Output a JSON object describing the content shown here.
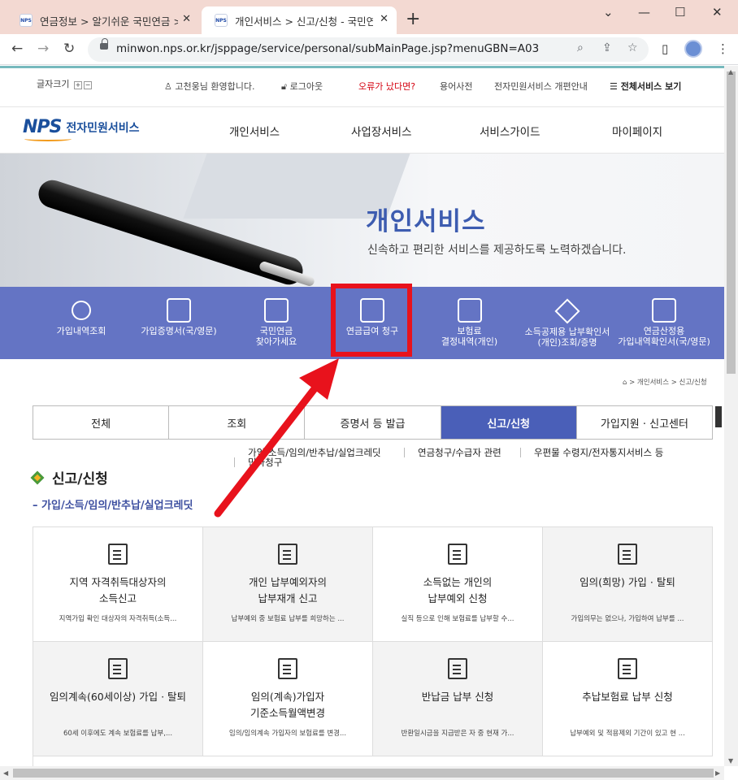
{
  "browser": {
    "tabs": [
      {
        "favicon": "NPS",
        "title": "연금정보 > 알기쉬운 국민연금 > 연금제도",
        "close": "✕"
      },
      {
        "favicon": "NPS",
        "title": "개인서비스 > 신고/신청 - 국민연금",
        "close": "✕"
      }
    ],
    "new_tab": "+",
    "window_controls": {
      "minimize": "—",
      "maximize": "☐",
      "close": "✕",
      "dropdown": "⌄"
    },
    "nav": {
      "back": "←",
      "forward": "→",
      "reload": "↻"
    },
    "url": "minwon.nps.or.kr/jsppage/service/personal/subMainPage.jsp?menuGBN=A03",
    "icons": {
      "zoom": "⌕",
      "share": "⇪",
      "bookmark": "☆",
      "sidepanel": "▯",
      "menu": "⋮"
    }
  },
  "utility": {
    "font_size_label": "글자크기",
    "plus": "+",
    "minus": "−",
    "greeting": "고천웅님 환영합니다.",
    "logout": "로그아웃",
    "error_report": "오류가 났다면?",
    "glossary": "용어사전",
    "renewal_notice": "전자민원서비스 개편안내",
    "all_services": "☰ 전체서비스 보기"
  },
  "logo": {
    "mark": "NPS",
    "text": "전자민원서비스"
  },
  "gnb": [
    "개인서비스",
    "사업장서비스",
    "서비스가이드",
    "마이페이지"
  ],
  "banner": {
    "title": "개인서비스",
    "subtitle": "신속하고 편리한 서비스를 제공하도록 노력하겠습니다."
  },
  "quick_menu": [
    {
      "line1": "가입내역조회",
      "line2": ""
    },
    {
      "line1": "가입증명서(국/영문)",
      "line2": ""
    },
    {
      "line1": "국민연금",
      "line2": "찾아가세요"
    },
    {
      "line1": "연금급여 청구",
      "line2": ""
    },
    {
      "line1": "보험료",
      "line2": "결정내역(개인)"
    },
    {
      "line1": "소득공제용 납부확인서",
      "line2": "(개인)조회/증명"
    },
    {
      "line1": "연금산정용",
      "line2": "가입내역확인서(국/영문)"
    }
  ],
  "breadcrumb": {
    "home_icon": "⌂",
    "path": " > 개인서비스 > 신고/신청"
  },
  "tabs": [
    "전체",
    "조회",
    "증명서 등 발급",
    "신고/신청",
    "가입지원 · 신고센터"
  ],
  "active_tab": "신고/신청",
  "subnav": [
    "가입/소득/임의/반추납/실업크레딧",
    "연금청구/수급자 관련",
    "우편물 수령지/전자통지서비스 등",
    "민사청구"
  ],
  "section": {
    "title": "신고/신청",
    "subtitle": "가입/소득/임의/반추납/실업크레딧",
    "dash": "–"
  },
  "cards": [
    {
      "title1": "지역 자격취득대상자의",
      "title2": "소득신고",
      "desc": "지역가입 확인 대상자의 자격취득(소득..."
    },
    {
      "title1": "개인 납부예외자의",
      "title2": "납부재개 신고",
      "desc": "납부예외 중 보험료 납부를 희망하는 ..."
    },
    {
      "title1": "소득없는 개인의",
      "title2": "납부예외 신청",
      "desc": "실직 등으로 인해 보험료를 납부할 수..."
    },
    {
      "title1": "임의(희망) 가입 · 탈퇴",
      "title2": "",
      "desc": "가입의무는 없으나, 가입하여 납부를 ..."
    },
    {
      "title1": "임의계속(60세이상) 가입 · 탈퇴",
      "title2": "",
      "desc": "60세 이후에도 계속 보험료를 납부,..."
    },
    {
      "title1": "임의(계속)가입자",
      "title2": "기준소득월액변경",
      "desc": "임의/임의계속 가입자의 보험료를 변경..."
    },
    {
      "title1": "반납금 납부 신청",
      "title2": "",
      "desc": "반환일시금을 지급받은 자 중 현재 가..."
    },
    {
      "title1": "추납보험료 납부 신청",
      "title2": "",
      "desc": "납부예외 및 적용제외 기간이 있고 현 ..."
    }
  ],
  "colors": {
    "quick_menu_bg": "#6474c4",
    "active_tab_bg": "#4a5fb8",
    "highlight_red": "#e8121c",
    "banner_title": "#3d5cb0"
  }
}
